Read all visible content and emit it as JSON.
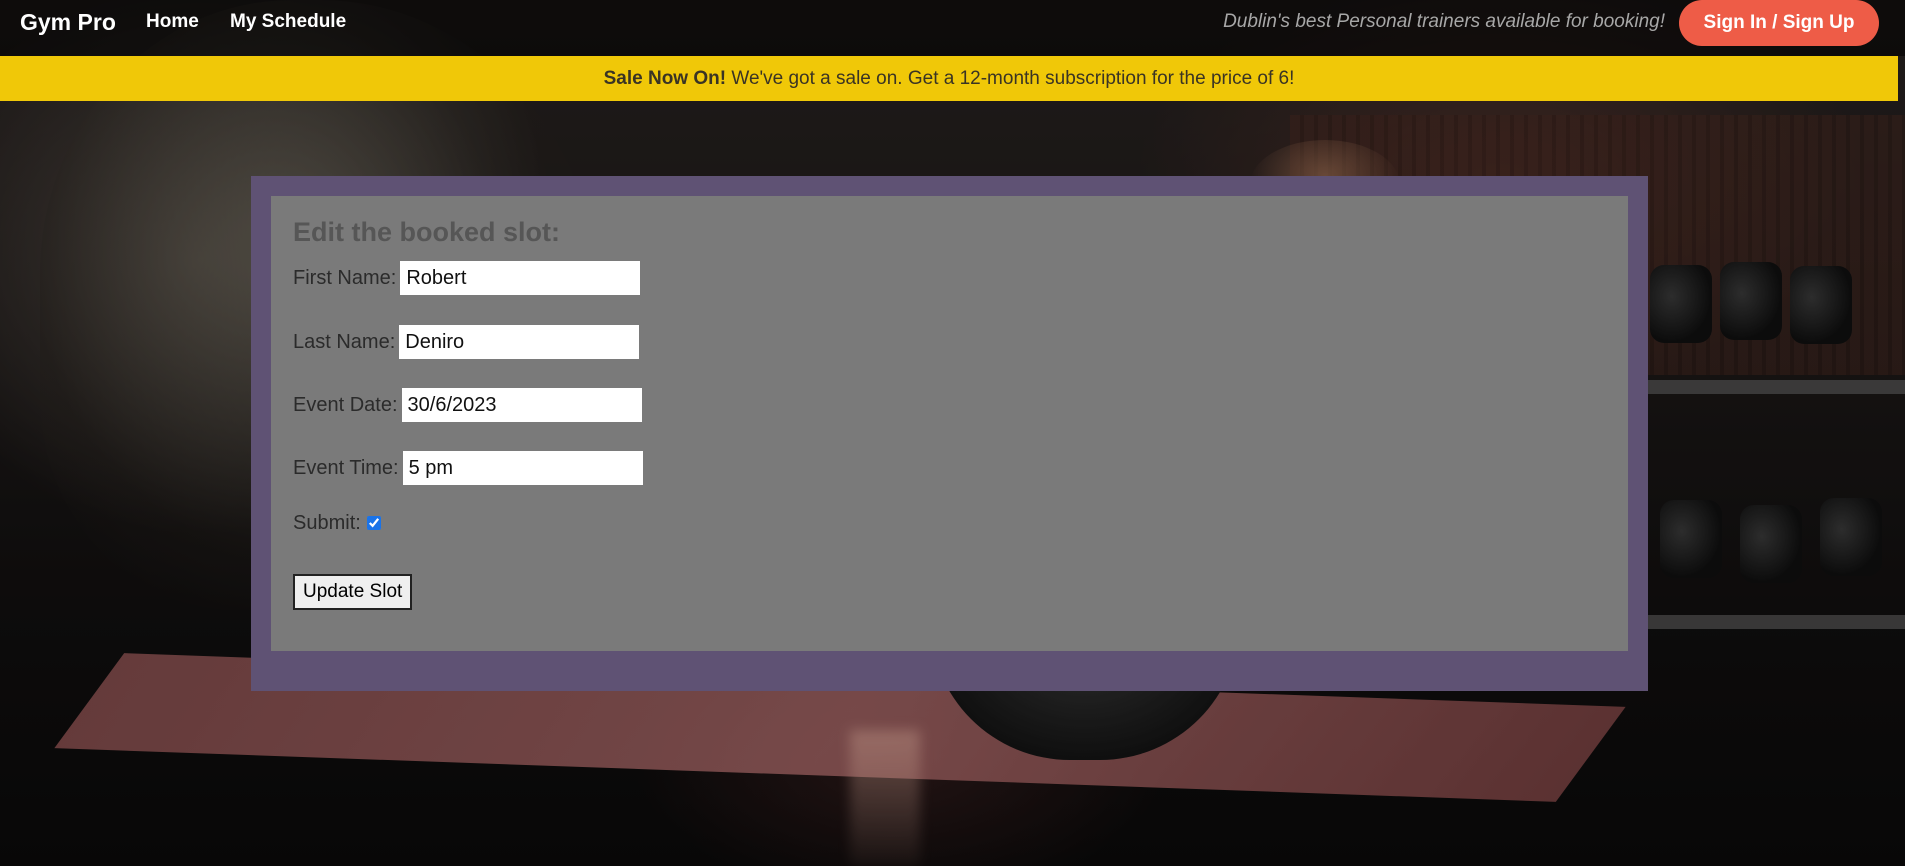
{
  "nav": {
    "brand": "Gym Pro",
    "links": [
      {
        "label": "Home"
      },
      {
        "label": "My Schedule"
      }
    ],
    "tagline": "Dublin's best Personal trainers available for booking!",
    "signin_label": "Sign In / Sign Up"
  },
  "banner": {
    "bold_text": "Sale Now On!",
    "text": " We've got a sale on. Get a 12-month subscription for the price of 6!"
  },
  "form": {
    "title": "Edit the booked slot:",
    "first_name": {
      "label": "First Name:",
      "value": "Robert"
    },
    "last_name": {
      "label": "Last Name:",
      "value": "Deniro"
    },
    "event_date": {
      "label": "Event Date:",
      "value": "30/6/2023"
    },
    "event_time": {
      "label": "Event Time:",
      "value": "5 pm"
    },
    "submit": {
      "label": "Submit:",
      "checked": true
    },
    "update_label": "Update Slot"
  },
  "colors": {
    "nav_bg": "#000000",
    "signin_button": "#ee5c47",
    "banner_bg": "#f0c808",
    "card_border": "#5f5274",
    "card_bg": "#7a7a7a"
  }
}
